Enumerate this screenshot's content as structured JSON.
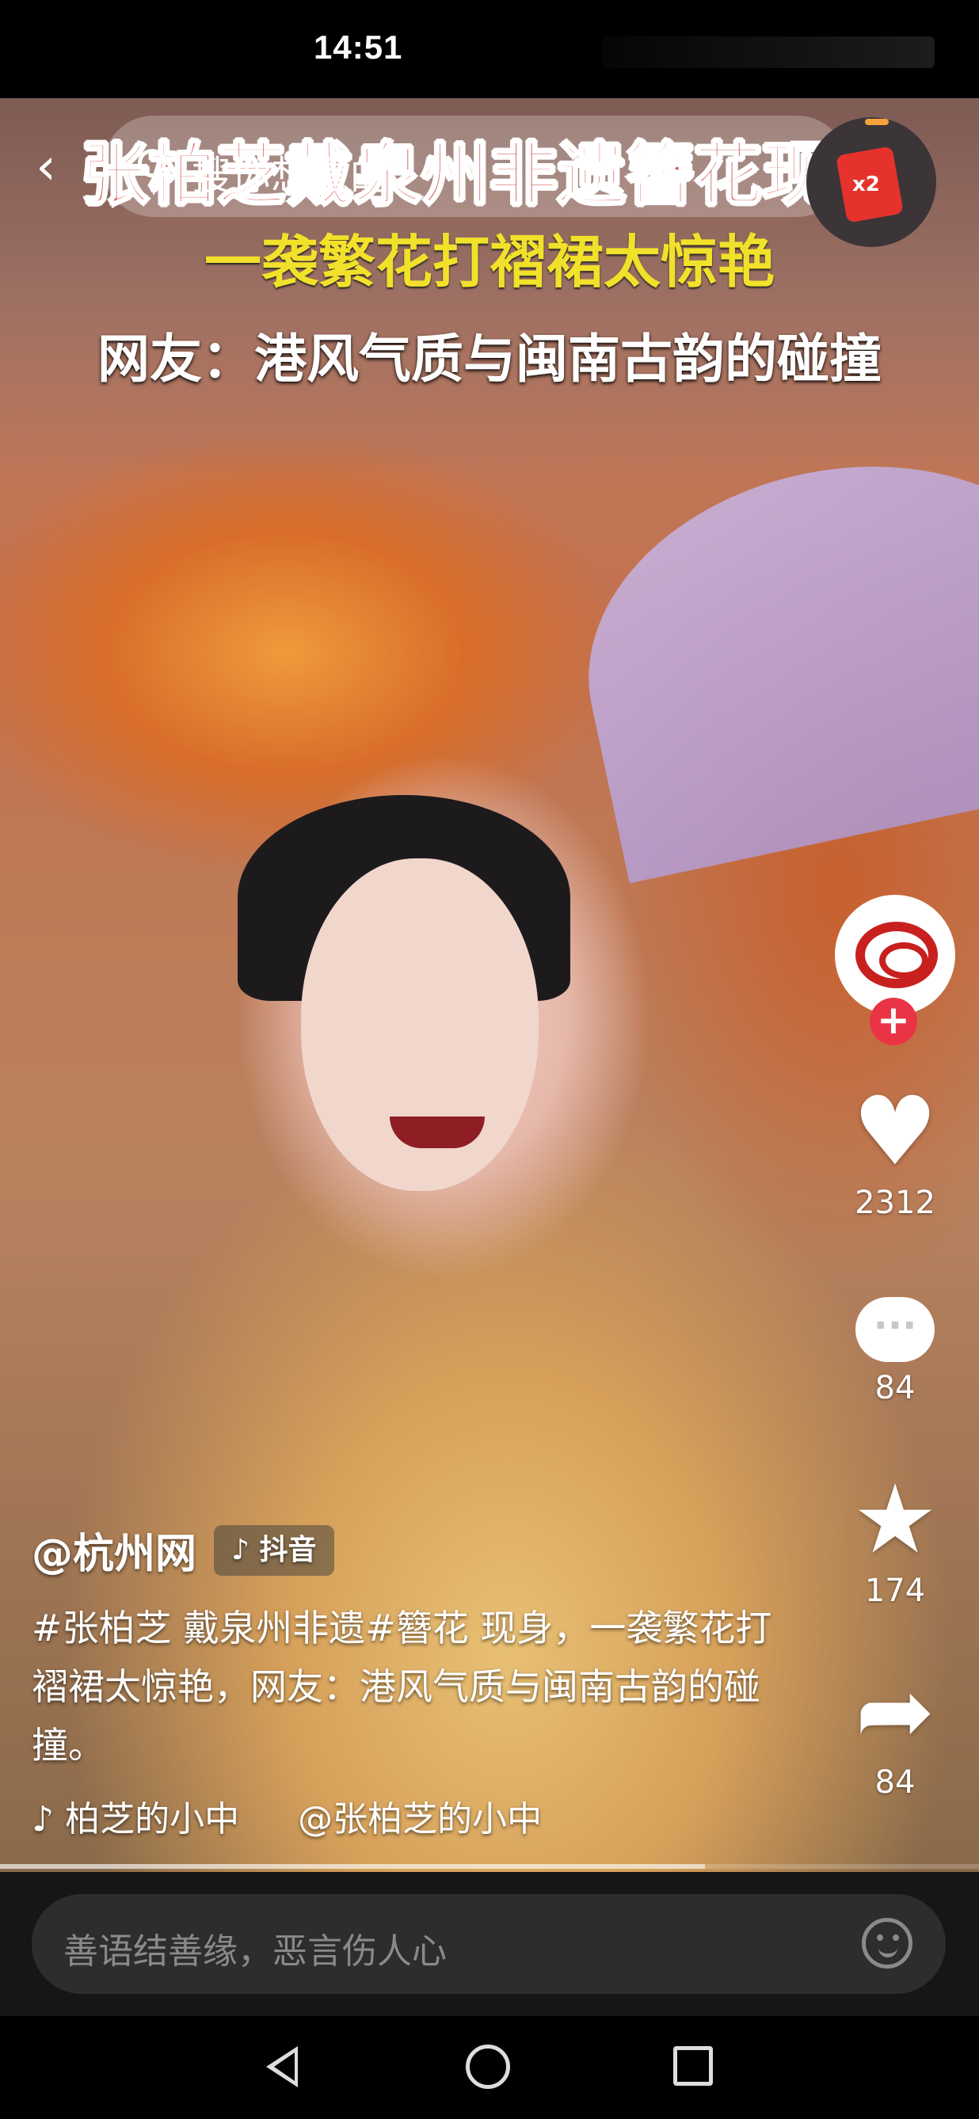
{
  "status_bar": {
    "time": "14:51"
  },
  "search": {
    "placeholder": "搜你想看的"
  },
  "reward": {
    "multiplier": "x2"
  },
  "video": {
    "headline_1": "张柏芝戴泉州非遗簪花现身",
    "headline_2": "一袭繁花打褶裙太惊艳",
    "headline_3": "网友：港风气质与闽南古韵的碰撞",
    "progress": 0.72
  },
  "actions": {
    "likes": "2312",
    "comments": "84",
    "favorites": "174",
    "shares": "84"
  },
  "caption": {
    "author": "@杭州网",
    "platform_badge": "♪ 抖音",
    "description": "#张柏芝 戴泉州非遗#簪花 现身，一袭繁花打褶裙太惊艳，网友：港风气质与闽南古韵的碰撞。",
    "music_1": "♪ 柏芝的小中",
    "music_2": "@张柏芝的小中"
  },
  "comment_bar": {
    "placeholder": "善语结善缘，恶言伤人心"
  },
  "icons": {
    "back": "chevron-left-icon",
    "search": "search-icon",
    "like": "heart-icon",
    "comment": "comment-bubble-icon",
    "favorite": "star-icon",
    "share": "share-arrow-icon",
    "emoji": "emoji-icon"
  },
  "colors": {
    "headline_red": "#c71e1e",
    "headline_yellow": "#f2e12a",
    "follow_badge": "#ea3445"
  }
}
